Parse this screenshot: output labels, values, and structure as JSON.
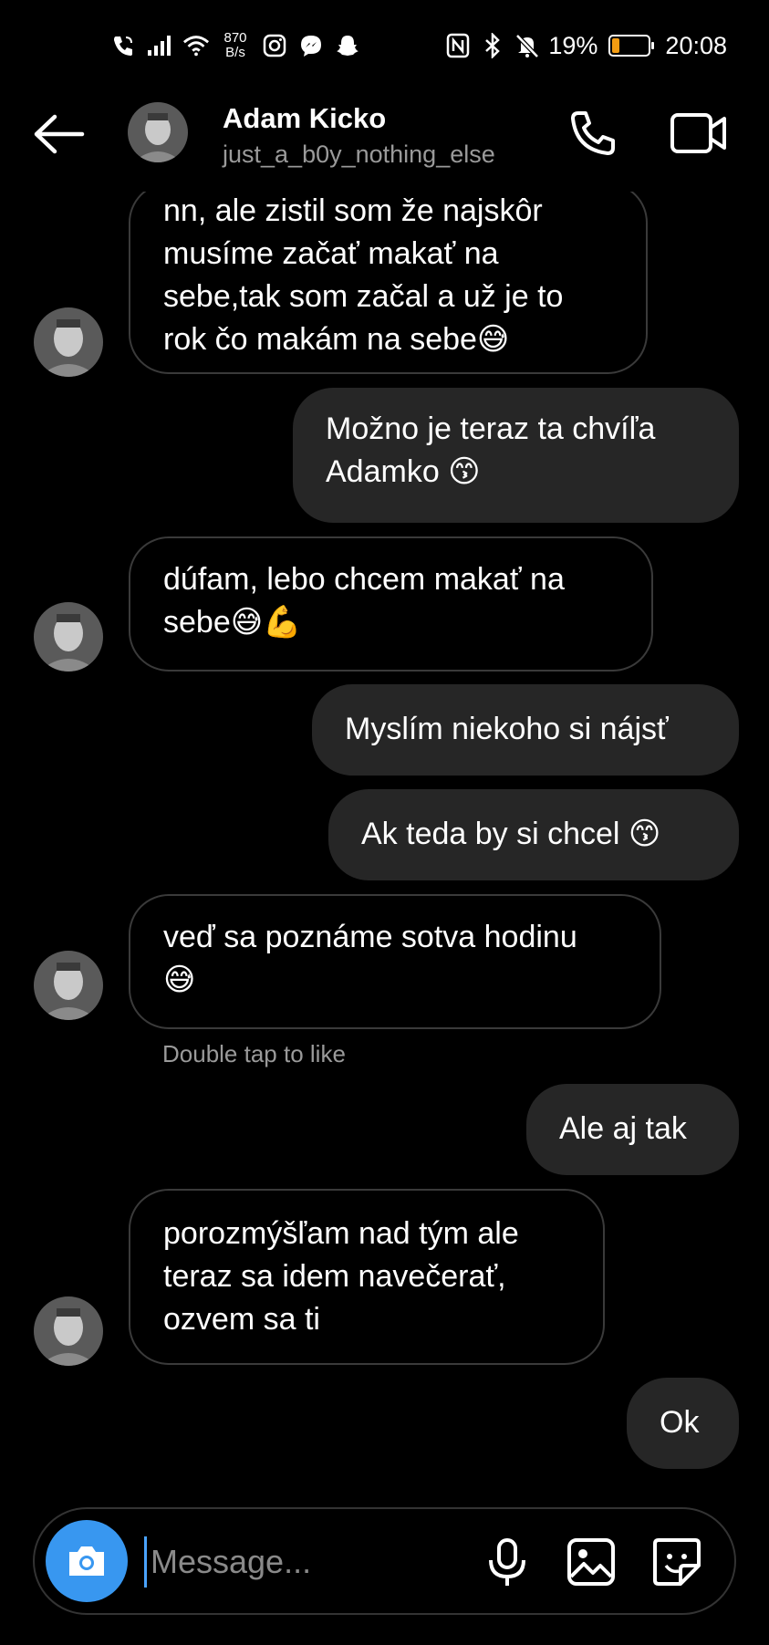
{
  "status_bar": {
    "net_speed_value": "870",
    "net_speed_unit": "B/s",
    "battery": "19%",
    "battery_level": 0.19,
    "battery_color": "#f39c12",
    "time": "20:08",
    "icons": [
      "wifi-call-icon",
      "signal-icon",
      "wifi-icon",
      "instagram-icon",
      "messenger-icon",
      "snapchat-icon",
      "nfc-icon",
      "bluetooth-icon",
      "mute-icon",
      "battery-icon"
    ]
  },
  "header": {
    "name": "Adam Kicko",
    "username": "just_a_b0y_nothing_else"
  },
  "messages": [
    {
      "side": "in",
      "lines": [
        "nn, ale zistil som že najskôr",
        "musíme začať makať na",
        "sebe,tak som začal a už je to",
        "rok čo makám na sebe😅"
      ]
    },
    {
      "side": "out",
      "lines": [
        "Možno je teraz ta chvíľa",
        "Adamko 😙"
      ]
    },
    {
      "side": "in",
      "lines": [
        "dúfam, lebo chcem makať na",
        "sebe😅💪"
      ]
    },
    {
      "side": "out",
      "lines": [
        "Myslím niekoho si nájsť"
      ]
    },
    {
      "side": "out",
      "lines": [
        "Ak teda by si chcel 😙"
      ]
    },
    {
      "side": "in",
      "lines": [
        "veď sa poznáme sotva hodinu",
        "😅"
      ]
    },
    {
      "side": "out",
      "lines": [
        "Ale aj tak"
      ]
    },
    {
      "side": "in",
      "lines": [
        "porozmýšľam nad tým ale",
        "teraz sa idem navečerať,",
        "ozvem sa ti"
      ]
    },
    {
      "side": "out",
      "lines": [
        "Ok"
      ]
    }
  ],
  "hint": "Double tap to like",
  "composer": {
    "placeholder": "Message...",
    "cam_color": "#3897f0"
  }
}
